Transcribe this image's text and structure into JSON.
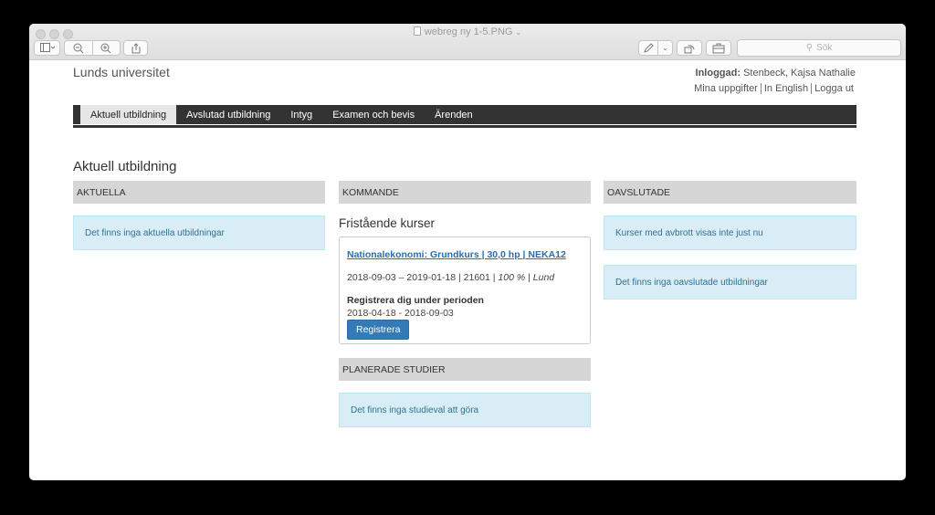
{
  "window": {
    "file_title": "webreg ny 1-5.PNG",
    "search_placeholder": "Sök",
    "toolbar": {
      "sidebar_icon": "sidebar-toggle-icon",
      "zoom_out_icon": "zoom-out-icon",
      "zoom_in_icon": "zoom-in-icon",
      "share_icon": "share-icon",
      "markup_icon": "pen-icon",
      "rotate_icon": "rotate-icon",
      "toolbox_icon": "toolbox-icon"
    }
  },
  "header": {
    "site_title": "Lunds universitet",
    "logged_in_label": "Inloggad:",
    "user_name": "Stenbeck, Kajsa Nathalie",
    "links": [
      "Mina uppgifter",
      "In English",
      "Logga ut"
    ]
  },
  "nav": {
    "items": [
      "Aktuell utbildning",
      "Avslutad utbildning",
      "Intyg",
      "Examen och bevis",
      "Ärenden"
    ],
    "active": "Aktuell utbildning"
  },
  "page": {
    "heading": "Aktuell utbildning",
    "aktuella": {
      "header": "AKTUELLA",
      "message": "Det finns inga aktuella utbildningar"
    },
    "kommande": {
      "header": "KOMMANDE",
      "subheading": "Fristående kurser",
      "course": {
        "link": "Nationalekonomi: Grundkurs | 30,0 hp | NEKA12",
        "meta_prefix": "2018-09-03 – 2019-01-18 | 21601 | ",
        "pace": "100 %",
        "meta_sep": " | ",
        "location": "Lund",
        "register_label": "Registrera dig under perioden",
        "register_period": "2018-04-18 - 2018-09-03",
        "register_button": "Registrera"
      }
    },
    "planerade": {
      "header": "PLANERADE STUDIER",
      "message": "Det finns inga studieval att göra"
    },
    "oavslutade": {
      "header": "OAVSLUTADE",
      "message1": "Kurser med avbrott visas inte just nu",
      "message2": "Det finns inga oavslutade utbildningar"
    }
  }
}
